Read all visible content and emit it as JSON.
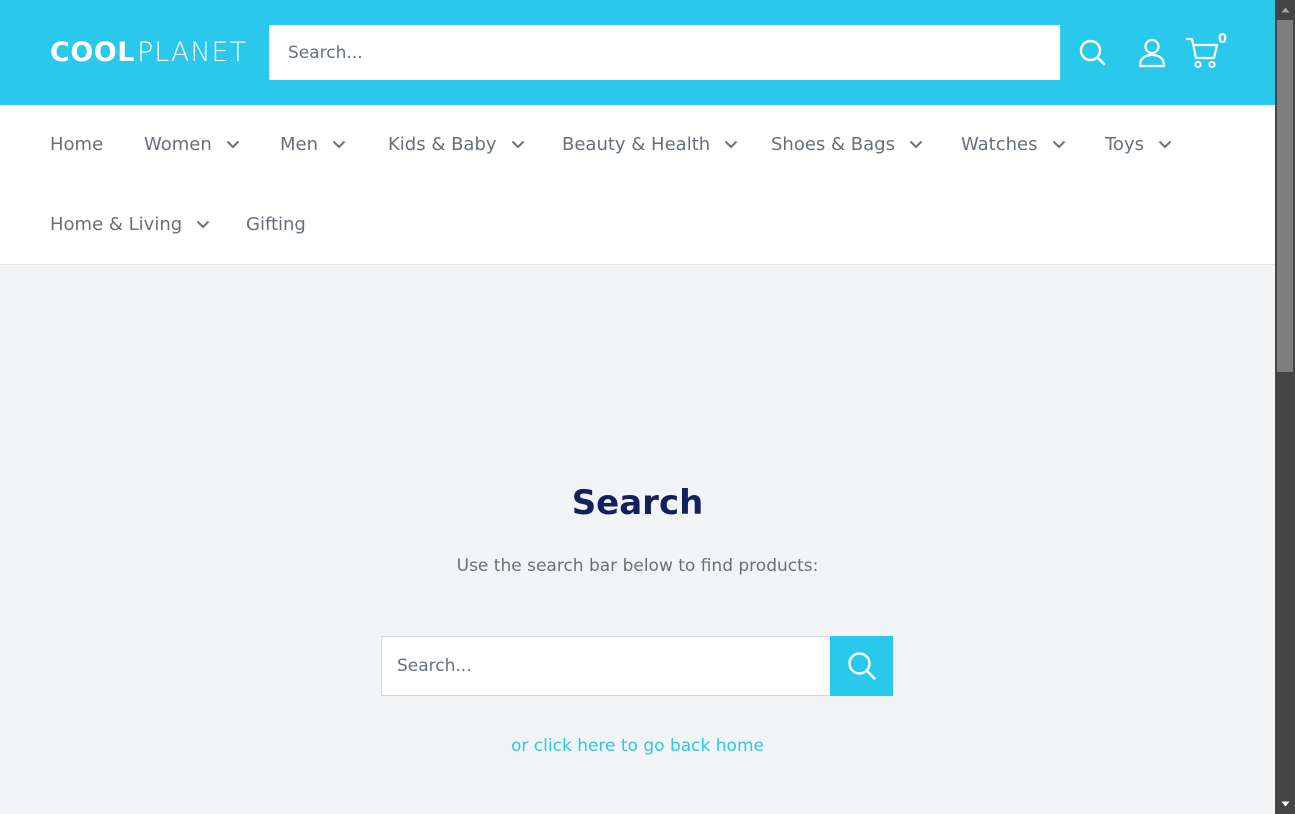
{
  "header": {
    "logo": {
      "bold": "COOL",
      "light": "PLANET"
    },
    "search_placeholder": "Search...",
    "cart_count": "0",
    "colors": {
      "brand": "#2ac8ea",
      "white": "#ffffff"
    },
    "icons": [
      "search-icon",
      "user-icon",
      "cart-icon"
    ]
  },
  "nav": {
    "items": [
      {
        "label": "Home",
        "has_dropdown": false
      },
      {
        "label": "Women",
        "has_dropdown": true
      },
      {
        "label": "Men",
        "has_dropdown": true
      },
      {
        "label": "Kids & Baby",
        "has_dropdown": true
      },
      {
        "label": "Beauty & Health",
        "has_dropdown": true
      },
      {
        "label": "Shoes & Bags",
        "has_dropdown": true
      },
      {
        "label": "Watches",
        "has_dropdown": true
      },
      {
        "label": "Toys",
        "has_dropdown": true
      },
      {
        "label": "Home & Living",
        "has_dropdown": true
      },
      {
        "label": "Gifting",
        "has_dropdown": false
      }
    ]
  },
  "main": {
    "title": "Search",
    "subtitle": "Use the search bar below to find products:",
    "search_placeholder": "Search...",
    "back_link": "or click here to go back home",
    "colors": {
      "title": "#13205a",
      "text": "#67707b",
      "link": "#2ac8ea",
      "background": "#f3f4f6"
    }
  }
}
